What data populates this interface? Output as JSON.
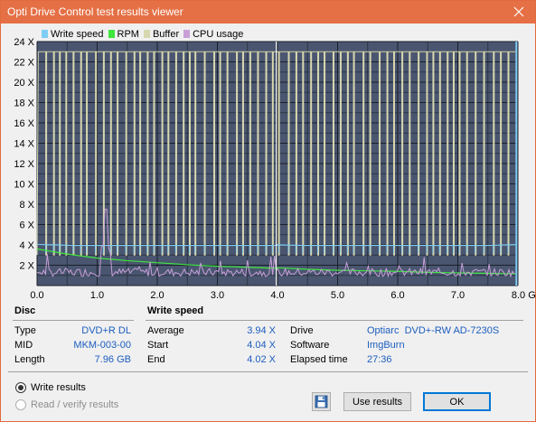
{
  "window": {
    "title": "Opti Drive Control test results viewer"
  },
  "legend": [
    {
      "label": "Write speed",
      "color": "#7fcdf5"
    },
    {
      "label": "RPM",
      "color": "#3ee63e"
    },
    {
      "label": "Buffer",
      "color": "#d8d8b0"
    },
    {
      "label": "CPU usage",
      "color": "#c8a0d8"
    }
  ],
  "chart_data": {
    "type": "line",
    "x_ticks": [
      "0.0",
      "1.0",
      "2.0",
      "3.0",
      "4.0",
      "5.0",
      "6.0",
      "7.0",
      "8.0 GB"
    ],
    "y_ticks": [
      "2 X",
      "4 X",
      "6 X",
      "8 X",
      "10 X",
      "12 X",
      "14 X",
      "16 X",
      "18 X",
      "20 X",
      "22 X",
      "24 X"
    ],
    "xlim": [
      0,
      8.0
    ],
    "ylim": [
      0,
      24
    ],
    "grid": true,
    "series": [
      {
        "name": "Write speed",
        "color": "#7fcdf5",
        "x": [
          0.0,
          0.3,
          0.6,
          1.0,
          1.5,
          2.0,
          2.5,
          3.0,
          3.5,
          3.95,
          4.0,
          4.5,
          5.0,
          5.5,
          6.0,
          6.5,
          7.0,
          7.5,
          7.96
        ],
        "y": [
          4.04,
          4.0,
          3.95,
          3.95,
          3.95,
          3.95,
          3.95,
          3.95,
          3.95,
          3.95,
          4.0,
          3.95,
          3.95,
          3.95,
          3.95,
          3.95,
          3.95,
          3.95,
          4.02
        ]
      },
      {
        "name": "RPM",
        "color": "#3ee63e",
        "x": [
          0.0,
          0.5,
          1.0,
          1.5,
          2.0,
          2.5,
          3.0,
          3.5,
          3.95,
          4.0,
          4.5,
          5.0,
          5.5,
          6.0,
          6.5,
          7.0,
          7.5,
          7.96
        ],
        "y": [
          3.6,
          3.1,
          2.7,
          2.45,
          2.25,
          2.05,
          1.9,
          1.8,
          1.7,
          1.75,
          1.6,
          1.5,
          1.45,
          1.4,
          1.3,
          1.25,
          1.2,
          1.15
        ]
      },
      {
        "name": "Buffer",
        "color": "#d8d8b0",
        "style": "mostly near top with periodic drops",
        "top_value": 23,
        "drop_value": 3
      },
      {
        "name": "CPU usage",
        "color": "#c8a0d8",
        "style": "noisy low",
        "baseline": 1.3,
        "peak_x": 1.15,
        "peak_y": 7.5
      }
    ]
  },
  "disc": {
    "header": "Disc",
    "rows": [
      {
        "label": "Type",
        "value": "DVD+R DL"
      },
      {
        "label": "MID",
        "value": "MKM-003-00"
      },
      {
        "label": "Length",
        "value": "7.96 GB"
      }
    ]
  },
  "write_speed": {
    "header": "Write speed",
    "rows": [
      {
        "label": "Average",
        "value": "3.94 X"
      },
      {
        "label": "Start",
        "value": "4.04 X"
      },
      {
        "label": "End",
        "value": "4.02 X"
      }
    ]
  },
  "drive_info": {
    "rows": [
      {
        "label": "Drive",
        "value": "Optiarc  DVD+-RW AD-7230S"
      },
      {
        "label": "Software",
        "value": "ImgBurn"
      },
      {
        "label": "Elapsed time",
        "value": "27:36"
      }
    ]
  },
  "options": {
    "write_results": "Write results",
    "read_verify_results": "Read / verify results"
  },
  "buttons": {
    "use_results": "Use results",
    "ok": "OK"
  }
}
